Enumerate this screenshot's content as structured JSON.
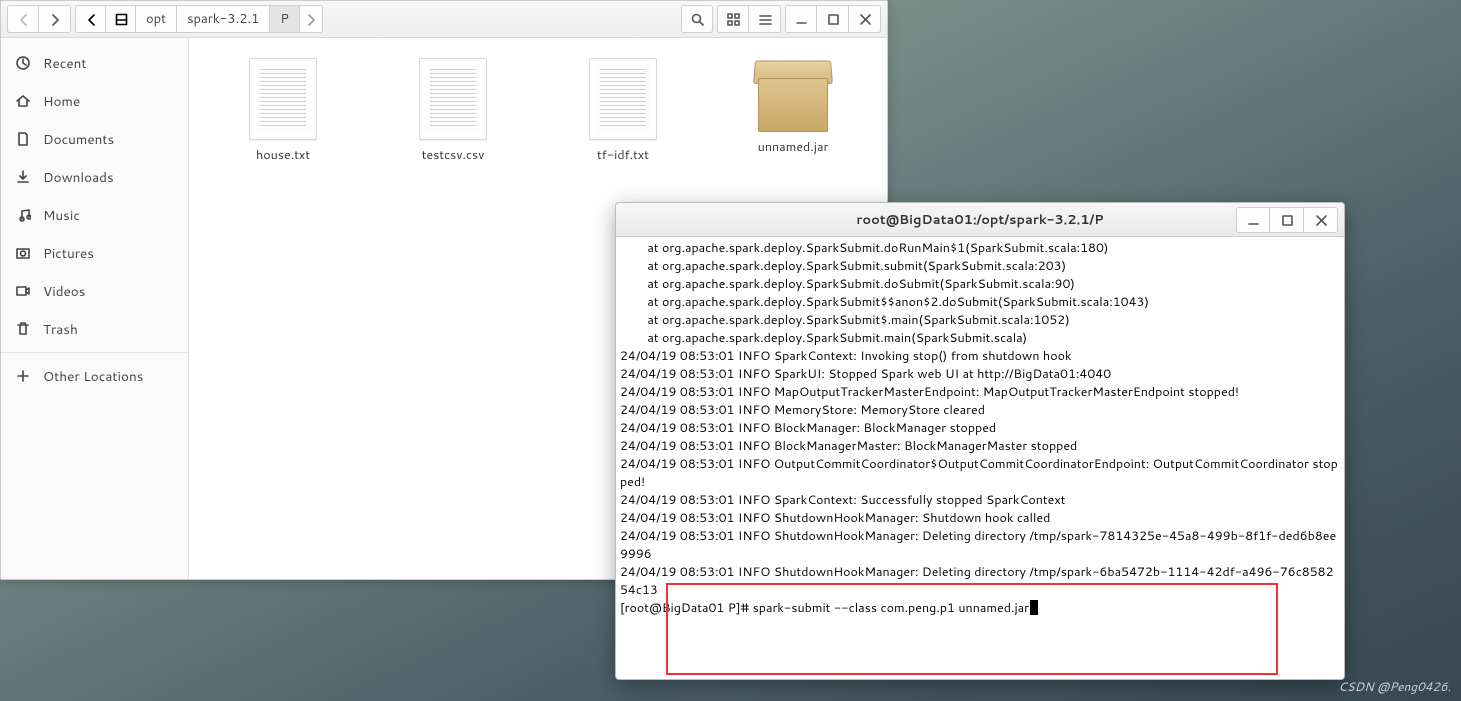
{
  "file_manager": {
    "breadcrumb": {
      "seg1": "opt",
      "seg2": "spark-3.2.1",
      "seg3": "P"
    },
    "sidebar": {
      "items": [
        {
          "label": "Recent",
          "icon": "clock-icon"
        },
        {
          "label": "Home",
          "icon": "home-icon"
        },
        {
          "label": "Documents",
          "icon": "file-icon"
        },
        {
          "label": "Downloads",
          "icon": "download-icon"
        },
        {
          "label": "Music",
          "icon": "music-icon"
        },
        {
          "label": "Pictures",
          "icon": "camera-icon"
        },
        {
          "label": "Videos",
          "icon": "video-icon"
        },
        {
          "label": "Trash",
          "icon": "trash-icon"
        }
      ],
      "other": "Other Locations"
    },
    "files": {
      "f0": "house.txt",
      "f1": "testcsv.csv",
      "f2": "tf-idf.txt",
      "f3": "unnamed.jar"
    }
  },
  "terminal": {
    "title": "root@BigData01:/opt/spark-3.2.1/P",
    "output": "        at org.apache.spark.deploy.SparkSubmit.doRunMain$1(SparkSubmit.scala:180)\n        at org.apache.spark.deploy.SparkSubmit.submit(SparkSubmit.scala:203)\n        at org.apache.spark.deploy.SparkSubmit.doSubmit(SparkSubmit.scala:90)\n        at org.apache.spark.deploy.SparkSubmit$$anon$2.doSubmit(SparkSubmit.scala:1043)\n        at org.apache.spark.deploy.SparkSubmit$.main(SparkSubmit.scala:1052)\n        at org.apache.spark.deploy.SparkSubmit.main(SparkSubmit.scala)\n24/04/19 08:53:01 INFO SparkContext: Invoking stop() from shutdown hook\n24/04/19 08:53:01 INFO SparkUI: Stopped Spark web UI at http://BigData01:4040\n24/04/19 08:53:01 INFO MapOutputTrackerMasterEndpoint: MapOutputTrackerMasterEndpoint stopped!\n24/04/19 08:53:01 INFO MemoryStore: MemoryStore cleared\n24/04/19 08:53:01 INFO BlockManager: BlockManager stopped\n24/04/19 08:53:01 INFO BlockManagerMaster: BlockManagerMaster stopped\n24/04/19 08:53:01 INFO OutputCommitCoordinator$OutputCommitCoordinatorEndpoint: OutputCommitCoordinator stopped!\n24/04/19 08:53:01 INFO SparkContext: Successfully stopped SparkContext\n24/04/19 08:53:01 INFO ShutdownHookManager: Shutdown hook called\n24/04/19 08:53:01 INFO ShutdownHookManager: Deleting directory /tmp/spark-7814325e-45a8-499b-8f1f-ded6b8ee9996\n24/04/19 08:53:01 INFO ShutdownHookManager: Deleting directory /tmp/spark-6ba5472b-1114-42df-a496-76c858254c13",
    "prompt": "[root@BigData01 P]# ",
    "command": "spark-submit --class com.peng.p1 unnamed.jar"
  },
  "watermark": "CSDN @Peng0426."
}
